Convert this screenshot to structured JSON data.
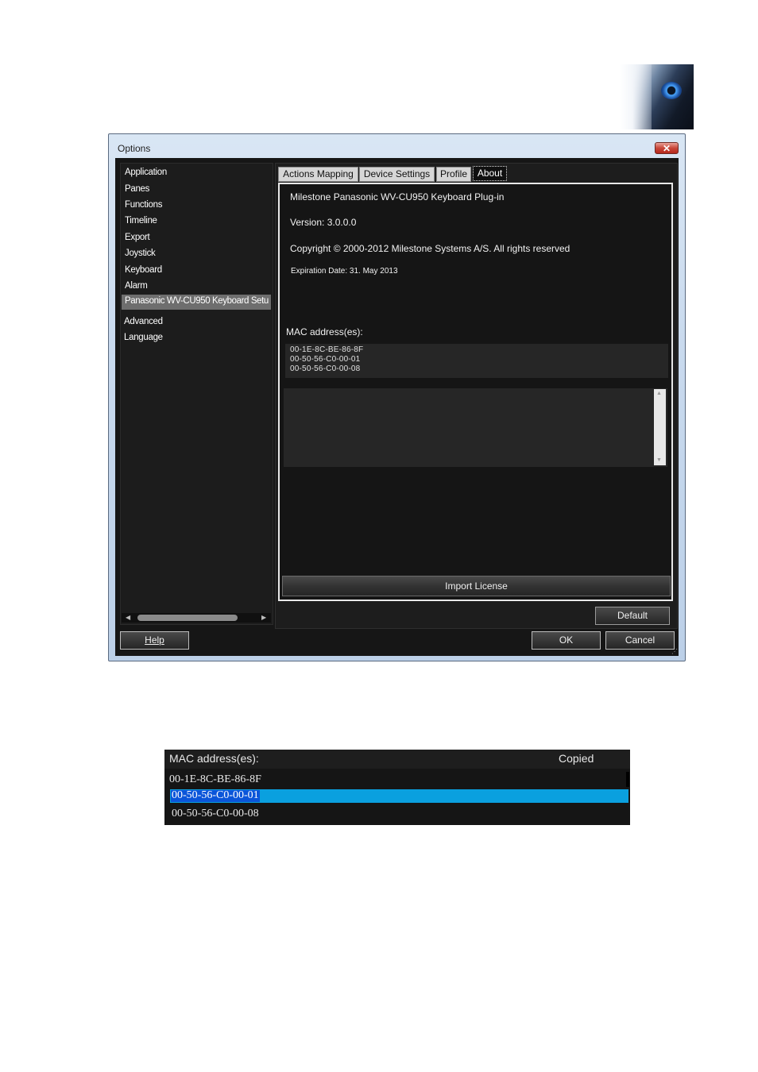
{
  "window": {
    "title": "Options",
    "close_label": "✕"
  },
  "sidebar": {
    "items": [
      {
        "label": "Application"
      },
      {
        "label": "Panes"
      },
      {
        "label": "Functions"
      },
      {
        "label": "Timeline"
      },
      {
        "label": "Export"
      },
      {
        "label": "Joystick"
      },
      {
        "label": "Keyboard"
      },
      {
        "label": "Alarm"
      },
      {
        "label": "Panasonic WV-CU950 Keyboard Setu",
        "selected": true
      },
      {
        "label": "Advanced"
      },
      {
        "label": "Language"
      }
    ]
  },
  "tabs": [
    {
      "label": "Actions Mapping"
    },
    {
      "label": "Device Settings"
    },
    {
      "label": "Profile"
    },
    {
      "label": "About",
      "active": true
    }
  ],
  "about": {
    "product": "Milestone Panasonic WV-CU950 Keyboard Plug-in",
    "version": "Version: 3.0.0.0",
    "copyright": "Copyright © 2000-2012 Milestone Systems A/S. All rights reserved",
    "expiration": "Expiration Date: 31. May 2013",
    "mac_label": "MAC address(es):",
    "mac_addresses": [
      "00-1E-8C-BE-86-8F",
      "00-50-56-C0-00-01",
      "00-50-56-C0-00-08"
    ],
    "license_text": ""
  },
  "buttons": {
    "import_license": "Import License",
    "default": "Default",
    "help": "Help",
    "ok": "OK",
    "cancel": "Cancel"
  },
  "zoom_strip": {
    "mac_label": "MAC address(es):",
    "status": "Copied",
    "mac_addresses": [
      "00-1E-8C-BE-86-8F",
      "00-50-56-C0-00-01",
      "00-50-56-C0-00-08"
    ],
    "selected_index": 1
  },
  "colors": {
    "selection_blue": "#0aa0df",
    "dark_background": "#161616",
    "nav_selected": "#6e6e6e"
  }
}
